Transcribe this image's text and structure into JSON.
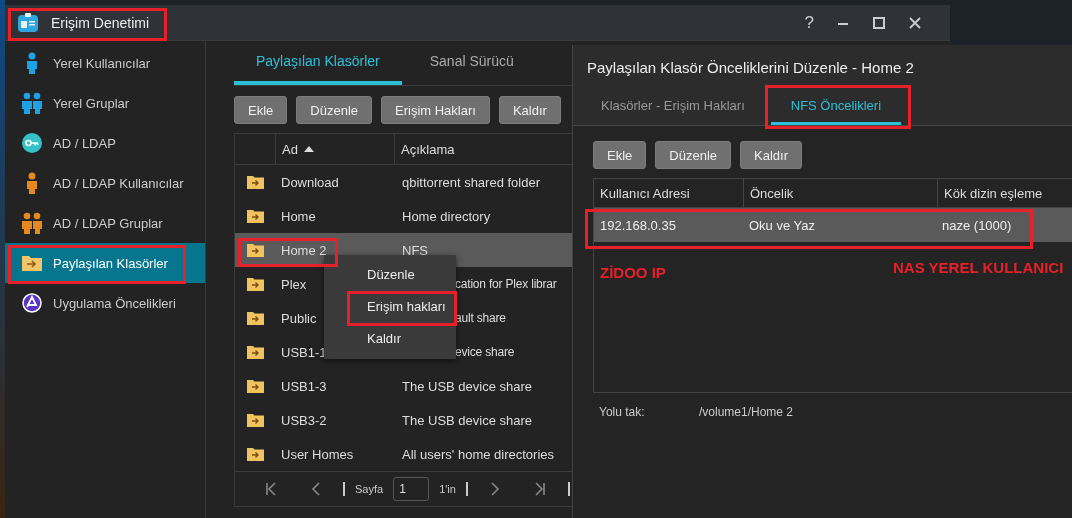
{
  "window": {
    "title": "Erişim Denetimi",
    "help": "?"
  },
  "sidebar": {
    "items": [
      {
        "label": "Yerel Kullanıcılar",
        "selected": false
      },
      {
        "label": "Yerel Gruplar",
        "selected": false
      },
      {
        "label": "AD / LDAP",
        "selected": false
      },
      {
        "label": "AD / LDAP Kullanıcılar",
        "selected": false
      },
      {
        "label": "AD / LDAP Gruplar",
        "selected": false
      },
      {
        "label": "Paylaşılan Klasörler",
        "selected": true
      },
      {
        "label": "Uygulama Öncelikleri",
        "selected": false
      }
    ]
  },
  "tabs": [
    {
      "label": "Paylaşılan Klasörler",
      "selected": true
    },
    {
      "label": "Sanal Sürücü",
      "selected": false
    }
  ],
  "toolbar": [
    "Ekle",
    "Düzenle",
    "Erişim Hakları",
    "Kaldır"
  ],
  "table": {
    "columns": [
      {
        "label": "Ad",
        "sorted": true
      },
      {
        "label": "Açıklama",
        "sorted": false
      }
    ],
    "rows": [
      {
        "name": "Download",
        "description": "qbittorrent shared folder",
        "selected": false,
        "clipped": false
      },
      {
        "name": "Home",
        "description": "Home directory",
        "selected": false,
        "clipped": false
      },
      {
        "name": "Home 2",
        "description": "NFS",
        "selected": true,
        "clipped": false
      },
      {
        "name": "Plex",
        "description": "cation for Plex librar",
        "selected": false,
        "clipped": true
      },
      {
        "name": "Public",
        "description": "ault share",
        "selected": false,
        "clipped": true
      },
      {
        "name": "USB1-1",
        "description": "evice share",
        "selected": false,
        "clipped": true
      },
      {
        "name": "USB1-3",
        "description": "The USB device share",
        "selected": false,
        "clipped": false
      },
      {
        "name": "USB3-2",
        "description": "The USB device share",
        "selected": false,
        "clipped": false
      },
      {
        "name": "User Homes",
        "description": "All users' home directories",
        "selected": false,
        "clipped": false
      }
    ]
  },
  "pager": {
    "label": "Sayfa",
    "page": "1",
    "of": "1'in"
  },
  "context_menu": [
    "Düzenle",
    "Erişim hakları",
    "Kaldır"
  ],
  "dialog": {
    "title": "Paylaşılan Klasör Önceliklerini Düzenle - Home 2",
    "tabs": [
      {
        "label": "Klasörler - Erişim Hakları",
        "selected": false
      },
      {
        "label": "NFS Öncelikleri",
        "selected": true
      }
    ],
    "buttons": [
      "Ekle",
      "Düzenle",
      "Kaldır"
    ],
    "columns": [
      "Kullanıcı Adresi",
      "Öncelik",
      "Kök dizin eşleme"
    ],
    "rows": [
      {
        "address": "192.168.0.35",
        "privilege": "Oku ve Yaz",
        "root_mapping": "naze (1000)",
        "selected": true
      }
    ],
    "mount_path": {
      "label": "Yolu tak:",
      "value": "/volume1/Home 2"
    }
  },
  "annotations": [
    "ZİDOO IP",
    "NAS YEREL KULLANICI"
  ]
}
